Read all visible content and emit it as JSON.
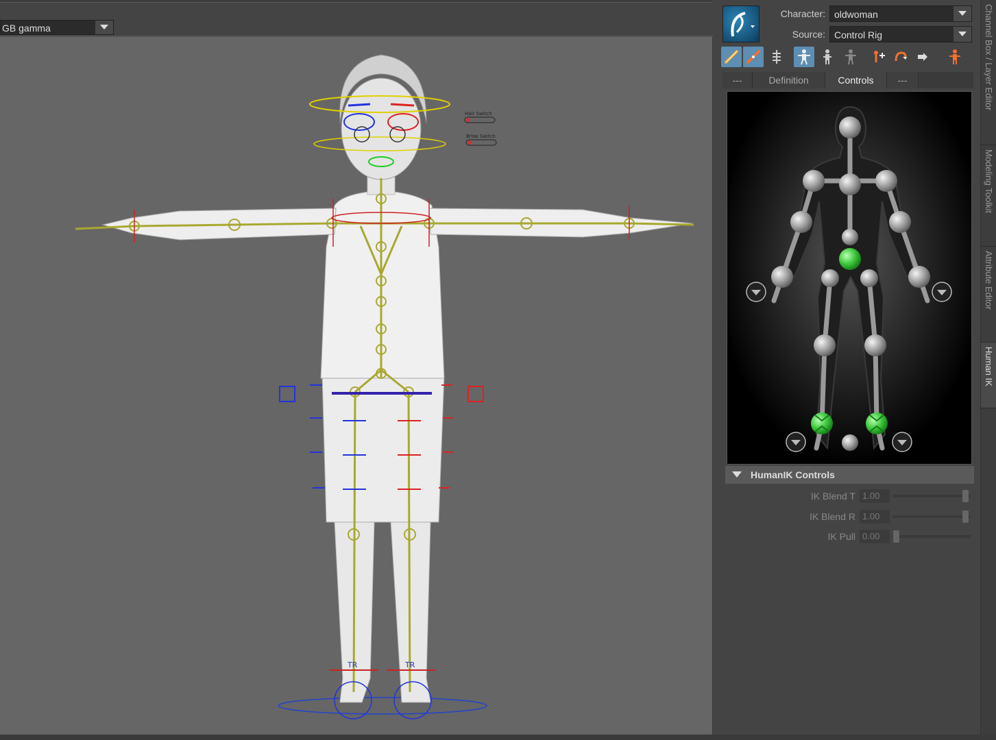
{
  "viewport": {
    "color_space": "GB gamma",
    "switch_labels": [
      "Hair Switch",
      "Brow Switch"
    ],
    "foot_labels": [
      "TR",
      "TR"
    ]
  },
  "humanik": {
    "character_label": "Character:",
    "character_value": "oldwoman",
    "source_label": "Source:",
    "source_value": "Control Rig",
    "toolbar_icons": [
      "full-body-ik-icon",
      "body-part-icon",
      "skeleton-icon",
      "character-active-icon",
      "character-stance-icon",
      "character-grey-icon",
      "pin-translation-icon",
      "pin-rotation-icon",
      "key-icon",
      "character-orange-icon"
    ],
    "tabs": [
      "---",
      "Definition",
      "Controls",
      "---"
    ],
    "active_tab": "Controls",
    "section_title": "HumanIK Controls",
    "attributes": [
      {
        "label": "IK Blend T",
        "value": "1.00",
        "fraction": 1.0
      },
      {
        "label": "IK Blend R",
        "value": "1.00",
        "fraction": 1.0
      },
      {
        "label": "IK Pull",
        "value": "0.00",
        "fraction": 0.0
      }
    ],
    "colors": {
      "active_effector": "#3ec83e",
      "toolbar_active": "#5d8eb3"
    }
  },
  "side_tabs": [
    "Channel Box / Layer Editor",
    "Modeling Toolkit",
    "Attribute Editor",
    "Human IK"
  ],
  "active_side_tab": "Human IK"
}
